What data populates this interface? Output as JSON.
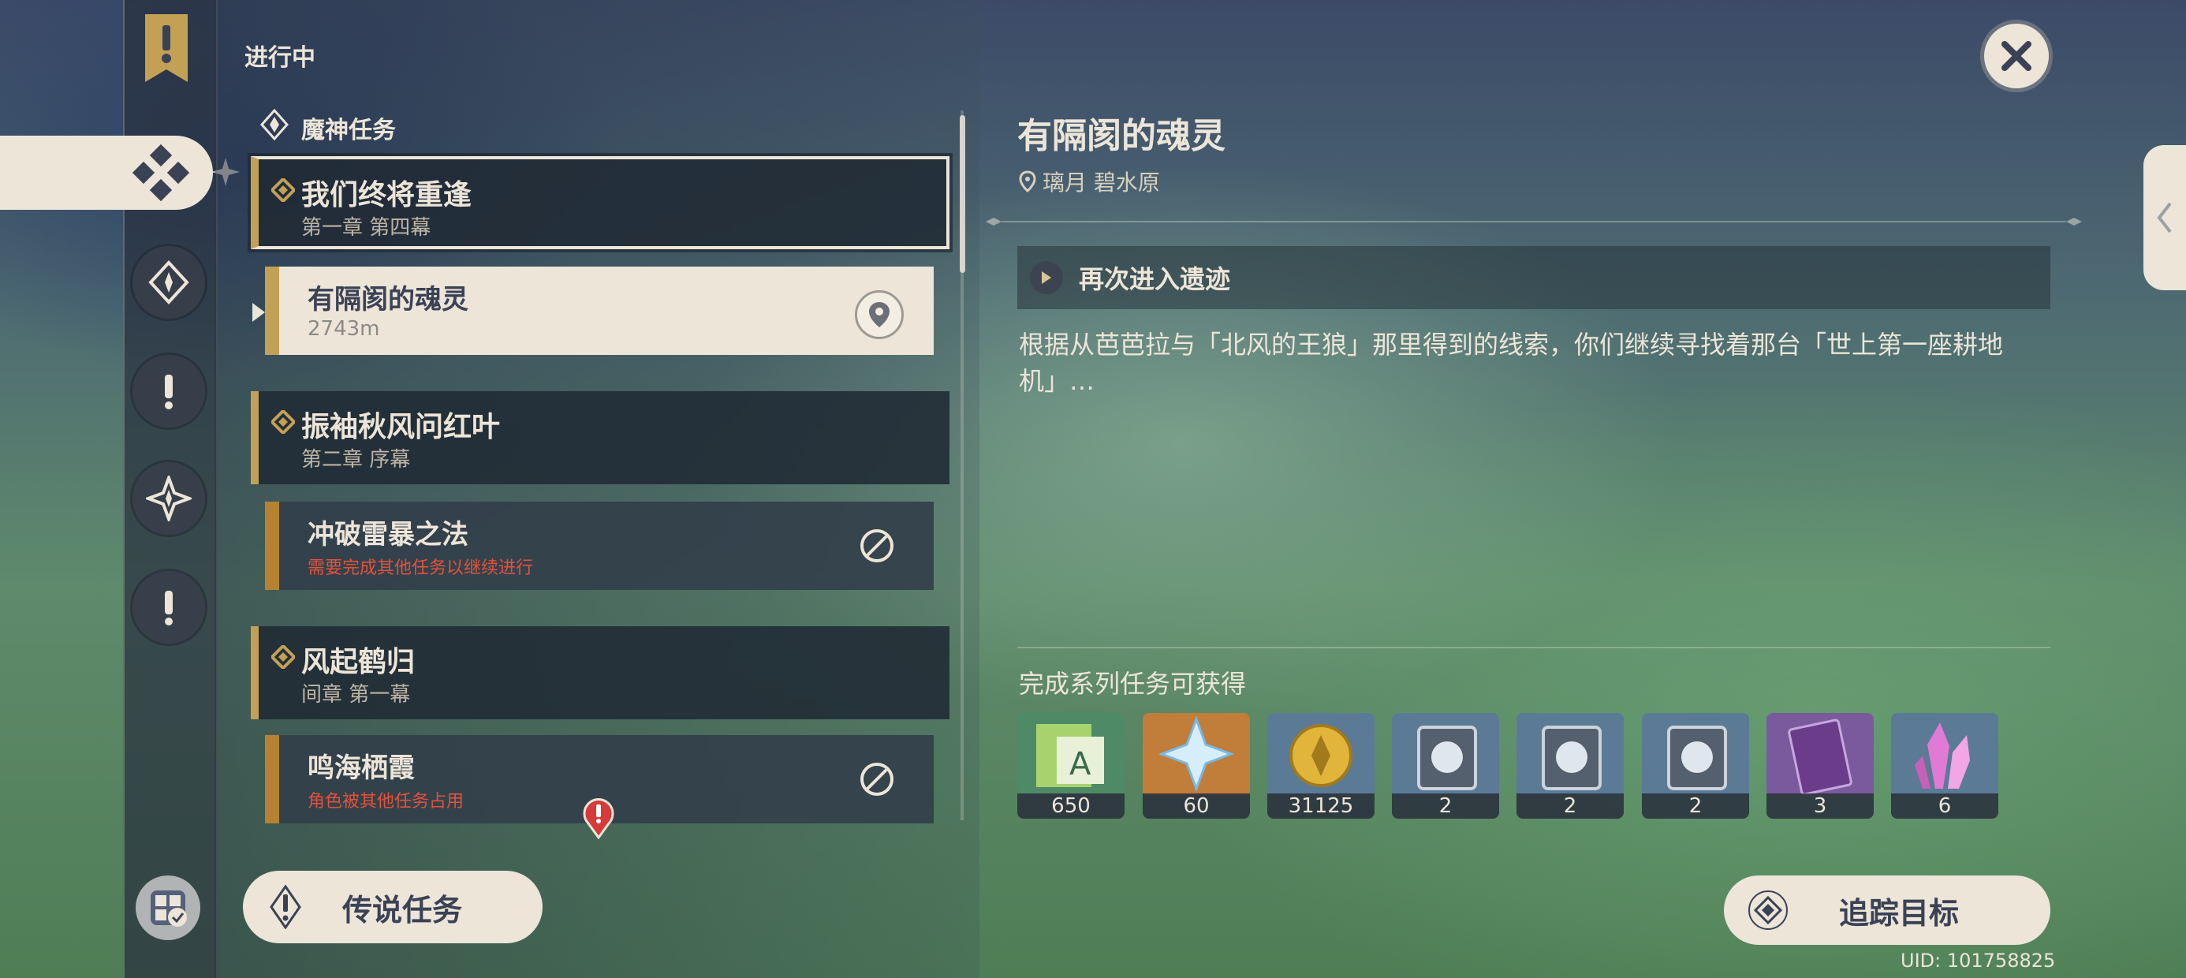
{
  "list": {
    "status_header": "进行中",
    "category_header": "魔神任务",
    "quests": [
      {
        "title": "我们终将重逢",
        "chapter": "第一章 第四幕"
      },
      {
        "title": "振袖秋风问红叶",
        "chapter": "第二章 序幕"
      },
      {
        "title": "风起鹤归",
        "chapter": "间章 第一幕"
      }
    ],
    "subquests": [
      {
        "title": "有隔阂的魂灵",
        "note": "2743m"
      },
      {
        "title": "冲破雷暴之法",
        "note": "需要完成其他任务以继续进行"
      },
      {
        "title": "鸣海栖霞",
        "note": "角色被其他任务占用"
      }
    ],
    "legend_button": "传说任务"
  },
  "detail": {
    "title": "有隔阂的魂灵",
    "location": "璃月 碧水原",
    "step": "再次进入遗迹",
    "description": "根据从芭芭拉与「北风的王狼」那里得到的线索，你们继续寻找着那台「世上第一座耕地机」…",
    "rewards_title": "完成系列任务可获得",
    "rewards": [
      {
        "icon": "adventure-exp-icon",
        "count": "650"
      },
      {
        "icon": "primogem-icon",
        "count": "60"
      },
      {
        "icon": "mora-icon",
        "count": "31125"
      },
      {
        "icon": "talent-book-freedom-icon",
        "count": "2"
      },
      {
        "icon": "talent-book-resistance-icon",
        "count": "2"
      },
      {
        "icon": "talent-book-ballad-icon",
        "count": "2"
      },
      {
        "icon": "heros-wit-icon",
        "count": "3"
      },
      {
        "icon": "enhancement-crystal-icon",
        "count": "6"
      }
    ],
    "track_button": "追踪目标"
  },
  "uid": "UID: 101758825",
  "colors": {
    "cream": "#ece5d8",
    "gold": "#c3a154",
    "dark_text": "#3b4255",
    "warning": "#e2523b"
  }
}
